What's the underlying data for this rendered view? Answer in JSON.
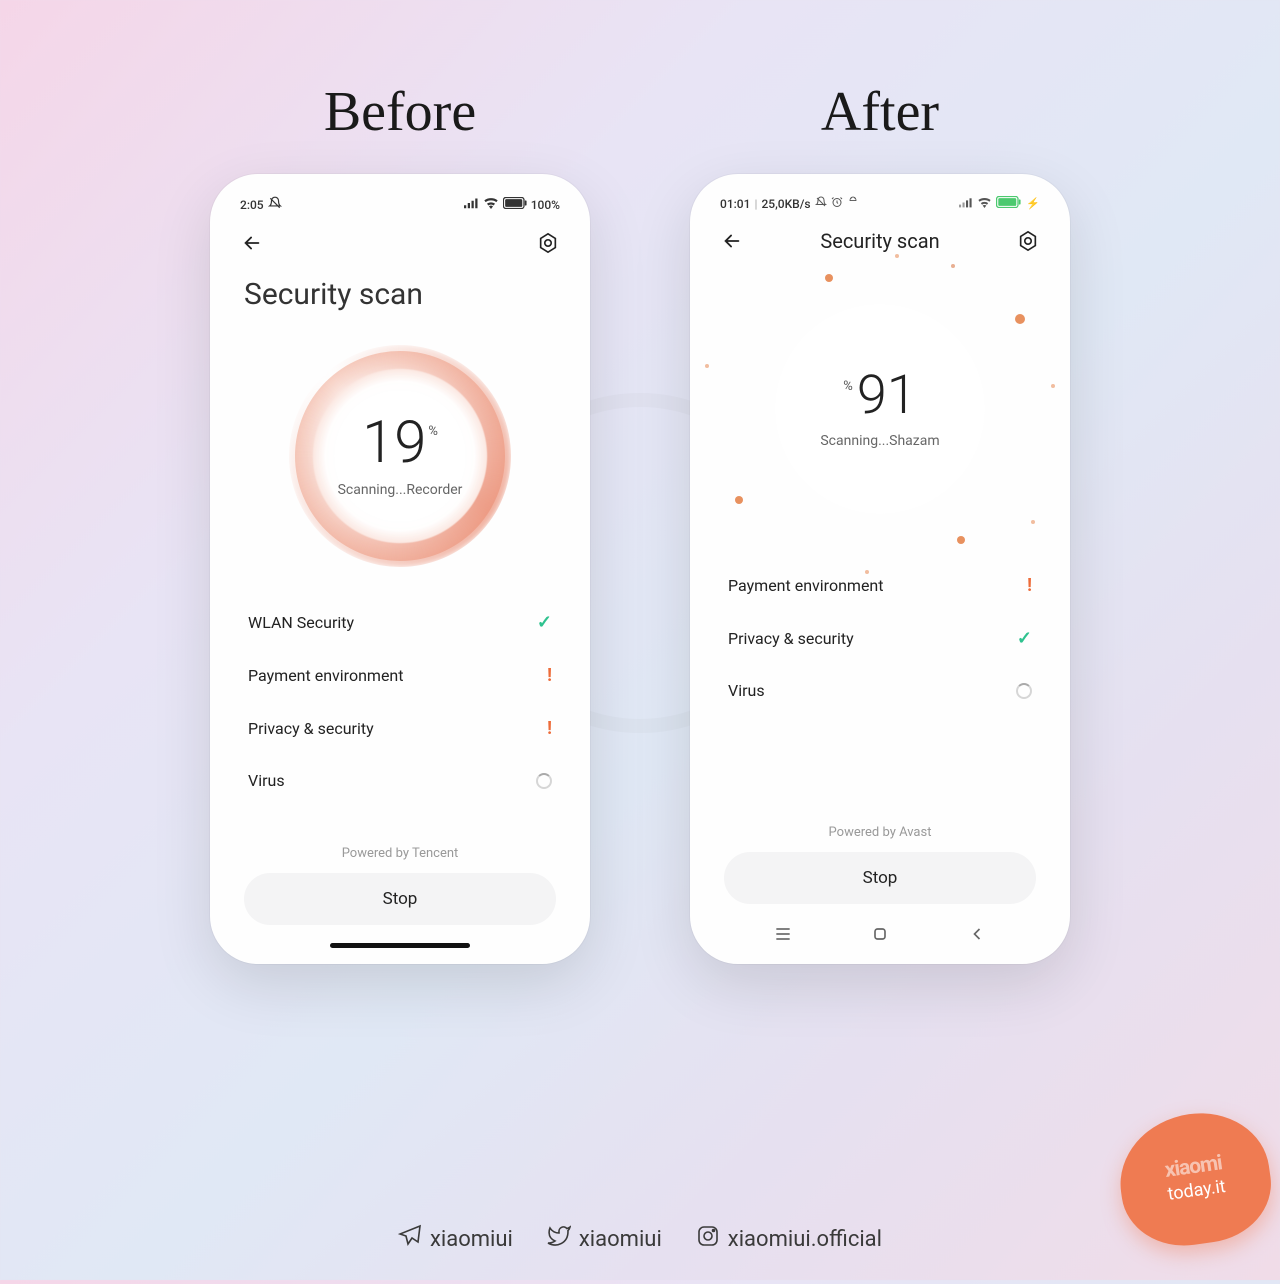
{
  "headings": {
    "before": "Before",
    "after": "After"
  },
  "credits": {
    "telegram": "xiaomiui",
    "twitter": "xiaomiui",
    "instagram": "xiaomiui.official"
  },
  "watermark": {
    "line1": "xiaomi",
    "line2": "today.it"
  },
  "before": {
    "status": {
      "time": "2:05",
      "battery": "100%"
    },
    "title": "Security scan",
    "score": "19",
    "percent": "%",
    "scanning": "Scanning...Recorder",
    "items": [
      {
        "label": "WLAN Security",
        "state": "check"
      },
      {
        "label": "Payment environment",
        "state": "warn"
      },
      {
        "label": "Privacy & security",
        "state": "warn"
      },
      {
        "label": "Virus",
        "state": "spin"
      }
    ],
    "powered": "Powered by Tencent",
    "stop": "Stop"
  },
  "after": {
    "status": {
      "time": "01:01",
      "net": "25,0KB/s"
    },
    "title": "Security scan",
    "score": "91",
    "percent": "%",
    "scanning": "Scanning...Shazam",
    "items": [
      {
        "label": "Payment environment",
        "state": "warn"
      },
      {
        "label": "Privacy & security",
        "state": "check"
      },
      {
        "label": "Virus",
        "state": "spin"
      }
    ],
    "powered": "Powered by Avast",
    "stop": "Stop"
  }
}
